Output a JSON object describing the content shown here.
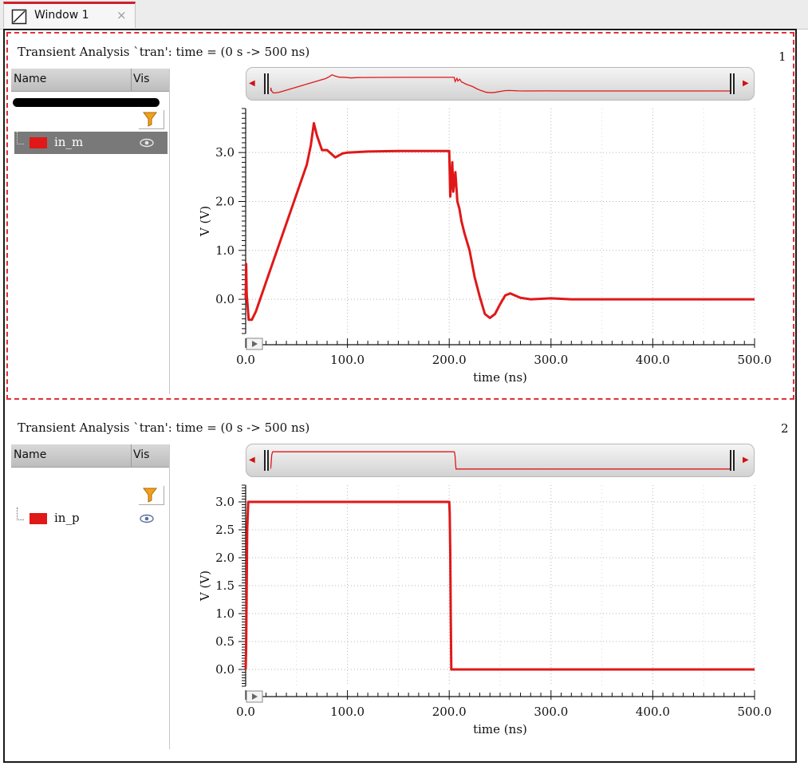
{
  "window": {
    "tab_label": "Window 1",
    "tab_icon": "plot-window-icon",
    "close_glyph": "×"
  },
  "colors": {
    "trace": "#e01818",
    "accent": "#d0202a",
    "grid": "#b5b5b5"
  },
  "panes": [
    {
      "title": "Transient Analysis `tran': time = (0 s -> 500 ns)",
      "number": "1",
      "columns": {
        "name": "Name",
        "vis": "Vis"
      },
      "signal": {
        "name": "in_m",
        "color": "#e01818",
        "selected": true,
        "visible_icon": "eye-icon"
      },
      "filter_icon": "funnel-icon",
      "play_icon": "play-icon"
    },
    {
      "title": "Transient Analysis `tran': time = (0 s -> 500 ns)",
      "number": "2",
      "columns": {
        "name": "Name",
        "vis": "Vis"
      },
      "signal": {
        "name": "in_p",
        "color": "#e01818",
        "selected": false,
        "visible_icon": "eye-icon"
      },
      "filter_icon": "funnel-icon",
      "play_icon": "play-icon"
    }
  ],
  "chart_data": [
    {
      "type": "line",
      "xlabel": "time (ns)",
      "ylabel": "V (V)",
      "xlim": [
        0,
        500
      ],
      "ylim": [
        -0.7,
        3.9
      ],
      "xticks": [
        "0.0",
        "100.0",
        "200.0",
        "300.0",
        "400.0",
        "500.0"
      ],
      "yticks": [
        "0.0",
        "1.0",
        "2.0",
        "3.0"
      ],
      "grid": true,
      "series": [
        {
          "name": "in_m",
          "x": [
            0,
            0.5,
            1,
            3,
            6,
            10,
            20,
            40,
            60,
            64,
            67,
            70,
            75,
            80,
            88,
            95,
            100,
            120,
            150,
            180,
            200,
            201,
            202,
            203,
            204,
            206,
            208,
            210,
            212,
            215,
            220,
            225,
            230,
            235,
            240,
            245,
            250,
            255,
            260,
            270,
            280,
            300,
            320,
            400,
            500
          ],
          "y": [
            0.0,
            0.72,
            0.1,
            -0.42,
            -0.42,
            -0.25,
            0.35,
            1.55,
            2.75,
            3.15,
            3.6,
            3.35,
            3.05,
            3.05,
            2.9,
            2.98,
            3.0,
            3.02,
            3.03,
            3.03,
            3.03,
            2.1,
            2.45,
            2.8,
            2.2,
            2.6,
            2.0,
            1.85,
            1.6,
            1.35,
            1.0,
            0.45,
            0.05,
            -0.3,
            -0.38,
            -0.3,
            -0.1,
            0.08,
            0.12,
            0.03,
            0.0,
            0.02,
            0.0,
            0.0,
            0.0
          ]
        }
      ]
    },
    {
      "type": "line",
      "xlabel": "time (ns)",
      "ylabel": "V (V)",
      "xlim": [
        0,
        500
      ],
      "ylim": [
        -0.3,
        3.3
      ],
      "xticks": [
        "0.0",
        "100.0",
        "200.0",
        "300.0",
        "400.0",
        "500.0"
      ],
      "yticks": [
        "0.0",
        "0.5",
        "1.0",
        "1.5",
        "2.0",
        "2.5",
        "3.0"
      ],
      "grid": true,
      "series": [
        {
          "name": "in_p",
          "x": [
            0,
            0.5,
            1.5,
            2.5,
            200,
            200.5,
            201,
            201.5,
            202,
            500
          ],
          "y": [
            0.0,
            0.4,
            2.5,
            3.0,
            3.0,
            2.8,
            2.1,
            1.0,
            0.0,
            0.0
          ]
        }
      ]
    }
  ]
}
